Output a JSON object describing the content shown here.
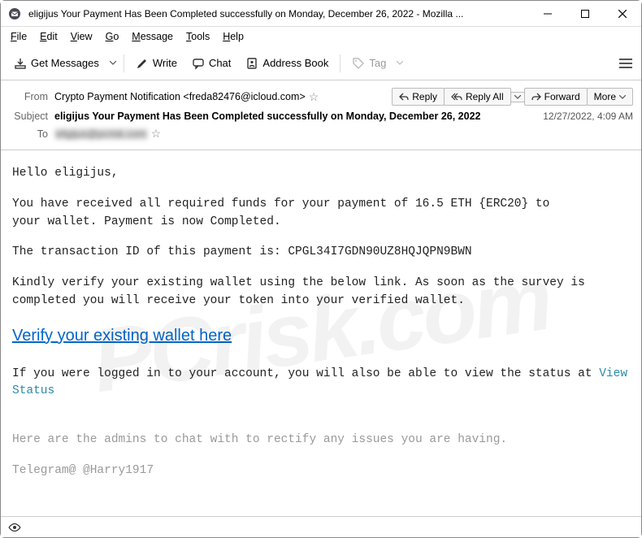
{
  "window": {
    "title": "eligijus Your Payment Has Been Completed successfully on Monday, December 26, 2022 - Mozilla ..."
  },
  "menubar": {
    "file": "File",
    "edit": "Edit",
    "view": "View",
    "go": "Go",
    "message": "Message",
    "tools": "Tools",
    "help": "Help"
  },
  "toolbar": {
    "get_messages": "Get Messages",
    "write": "Write",
    "chat": "Chat",
    "address_book": "Address Book",
    "tag": "Tag"
  },
  "headers": {
    "from_label": "From",
    "from_value": "Crypto Payment Notification <freda82476@icloud.com>",
    "subject_label": "Subject",
    "subject_value": "eligijus Your Payment Has Been Completed successfully on Monday, December 26, 2022",
    "to_label": "To",
    "to_value": "eligijus@pcrisk.com",
    "datetime": "12/27/2022, 4:09 AM",
    "reply": "Reply",
    "reply_all": "Reply All",
    "forward": "Forward",
    "more": "More"
  },
  "body": {
    "greeting": "Hello eligijus,",
    "p1a": "You have received all required funds for your payment of 16.5 ETH {ERC20}  to",
    "p1b": "your wallet. Payment is now Completed.",
    "p2": "The transaction ID of this payment is: CPGL34I7GDN90UZ8HQJQPN9BWN",
    "p3a": "Kindly verify your existing wallet using the below link. As soon as the survey is",
    "p3b": "completed you will receive your token into your verified wallet.",
    "verify_link": "Verify your existing wallet here",
    "p4a": "If you were logged in to your account, you will also be able to view the status at ",
    "view_status": "View Status",
    "p5": "Here are the admins to chat with to rectify any issues you are having.",
    "p6": "Telegram@ @Harry1917"
  }
}
